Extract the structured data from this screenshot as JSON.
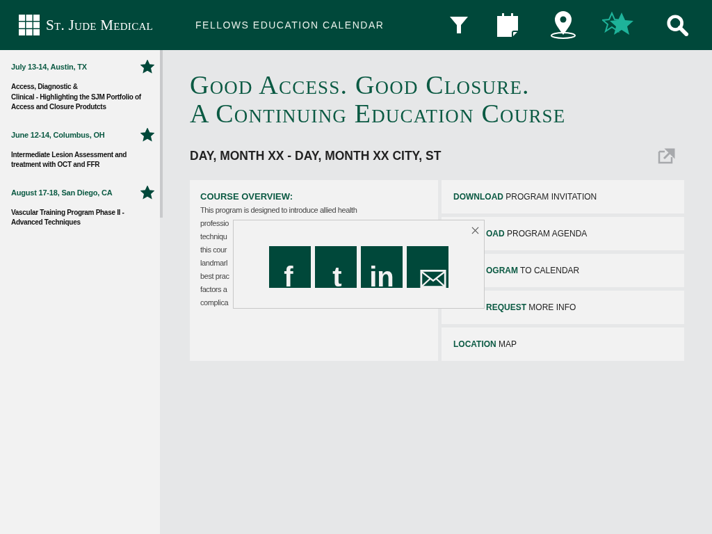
{
  "header": {
    "brand": "St. Jude Medical",
    "title": "FELLOWS EDUCATION CALENDAR",
    "tools": [
      {
        "kind": "filter",
        "selected": false
      },
      {
        "kind": "calendar",
        "selected": false
      },
      {
        "kind": "location",
        "selected": false
      },
      {
        "kind": "favorites",
        "selected": true
      },
      {
        "kind": "search",
        "selected": false
      }
    ]
  },
  "sidebar": {
    "items": [
      {
        "date": "July 13-14, Austin, TX",
        "starred": true,
        "title": "Access, Diagnostic &\nClinical - Highlighting the SJM Portfolio of Access and Closure Produtcts"
      },
      {
        "date": "June 12-14, Columbus, OH",
        "starred": true,
        "title": "Intermediate Lesion Assessment and treatment with OCT and FFR"
      },
      {
        "date": "August 17-18, San Diego, CA",
        "starred": true,
        "title": "Vascular Training Program Phase II - Advanced Techniques"
      }
    ]
  },
  "course": {
    "title_lines": [
      "Good Access. Good Closure.",
      "A Continuing Education Course"
    ],
    "dates": "DAY, MONTH XX - DAY, MONTH XX  CITY, ST",
    "overview": {
      "heading": "COURSE OVERVIEW:",
      "lines": [
        "This program is designed to introduce allied health",
        "professio",
        "techniqu",
        "this cour",
        "landmarl",
        "best prac",
        "factors a",
        "complica"
      ]
    },
    "actions": [
      {
        "kind": "plain",
        "strong": "DOWNLOAD",
        "text": "PROGRAM INVITATION"
      },
      {
        "kind": "covered",
        "strong": "OAD",
        "text": "PROGRAM AGENDA"
      },
      {
        "kind": "covered",
        "strong": "OGRAM",
        "text": "TO CALENDAR"
      },
      {
        "kind": "covered",
        "strong": "REQUEST",
        "text": "MORE INFO"
      },
      {
        "kind": "plain",
        "strong": "LOCATION",
        "text": "MAP"
      }
    ]
  },
  "share_popup": {
    "items": [
      {
        "kind": "facebook",
        "glyph": "f"
      },
      {
        "kind": "twitter",
        "glyph": "t"
      },
      {
        "kind": "linkedin",
        "glyph": "in"
      },
      {
        "kind": "email"
      }
    ]
  }
}
